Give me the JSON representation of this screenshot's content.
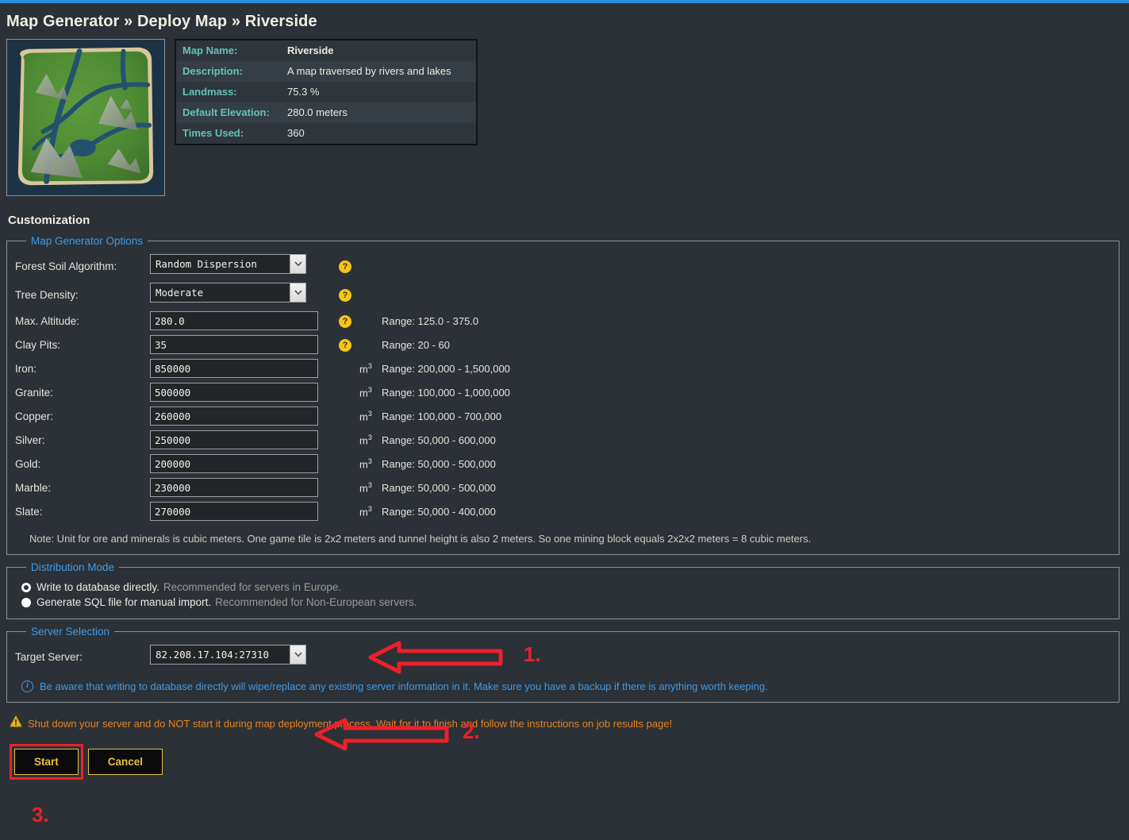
{
  "page_title": "Map Generator » Deploy Map » Riverside",
  "map_info": {
    "rows": [
      {
        "label": "Map Name:",
        "value": "Riverside"
      },
      {
        "label": "Description:",
        "value": "A map traversed by rivers and lakes"
      },
      {
        "label": "Landmass:",
        "value": "75.3 %"
      },
      {
        "label": "Default Elevation:",
        "value": "280.0 meters"
      },
      {
        "label": "Times Used:",
        "value": "360"
      }
    ]
  },
  "customization": {
    "title": "Customization",
    "map_generator_options": {
      "legend": "Map Generator Options",
      "forest_soil_algorithm": {
        "label": "Forest Soil Algorithm:",
        "value": "Random Dispersion",
        "help": "?"
      },
      "tree_density": {
        "label": "Tree Density:",
        "value": "Moderate",
        "help": "?"
      },
      "max_altitude": {
        "label": "Max. Altitude:",
        "value": "280.0",
        "help": "?",
        "range": "Range: 125.0 - 375.0"
      },
      "clay_pits": {
        "label": "Clay Pits:",
        "value": "35",
        "help": "?",
        "range": "Range: 20 - 60"
      },
      "ores": [
        {
          "label": "Iron:",
          "value": "850000",
          "unit": "m",
          "exp": "3",
          "range": "Range: 200,000 - 1,500,000"
        },
        {
          "label": "Granite:",
          "value": "500000",
          "unit": "m",
          "exp": "3",
          "range": "Range: 100,000 - 1,000,000"
        },
        {
          "label": "Copper:",
          "value": "260000",
          "unit": "m",
          "exp": "3",
          "range": "Range: 100,000 - 700,000"
        },
        {
          "label": "Silver:",
          "value": "250000",
          "unit": "m",
          "exp": "3",
          "range": "Range: 50,000 - 600,000"
        },
        {
          "label": "Gold:",
          "value": "200000",
          "unit": "m",
          "exp": "3",
          "range": "Range: 50,000 - 500,000"
        },
        {
          "label": "Marble:",
          "value": "230000",
          "unit": "m",
          "exp": "3",
          "range": "Range: 50,000 - 500,000"
        },
        {
          "label": "Slate:",
          "value": "270000",
          "unit": "m",
          "exp": "3",
          "range": "Range: 50,000 - 400,000"
        }
      ],
      "note": "Note: Unit for ore and minerals is cubic meters. One game tile is 2x2 meters and tunnel height is also 2 meters. So one mining block equals 2x2x2 meters = 8 cubic meters."
    },
    "distribution_mode": {
      "legend": "Distribution Mode",
      "options": [
        {
          "main": "Write to database directly.",
          "sub": "Recommended for servers in Europe.",
          "selected": true
        },
        {
          "main": "Generate SQL file for manual import.",
          "sub": "Recommended for Non-European servers.",
          "selected": false
        }
      ]
    },
    "server_selection": {
      "legend": "Server Selection",
      "target_server": {
        "label": "Target Server:",
        "value": "82.208.17.104:27310"
      },
      "info": "Be aware that writing to database directly will wipe/replace any existing server information in it. Make sure you have a backup if there is anything worth keeping."
    }
  },
  "warning": "Shut down your server and do NOT start it during map deployment process. Wait for it to finish and follow the instructions on job results page!",
  "buttons": {
    "start": "Start",
    "cancel": "Cancel"
  },
  "annotations": {
    "step1": "1.",
    "step2": "2.",
    "step3": "3."
  },
  "colors": {
    "accent_blue": "#3f9ae8",
    "teal_label": "#63c2b5",
    "annotation_red": "#ee1f2b",
    "warning_orange": "#e8821e",
    "button_gold": "#e8c13c",
    "help_yellow": "#f5c518",
    "page_bg": "#2b3136"
  }
}
